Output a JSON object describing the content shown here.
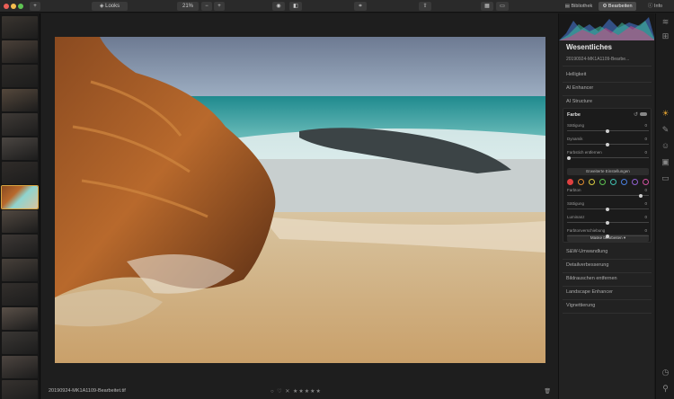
{
  "toolbar": {
    "add_label": "+",
    "looks_label": "Looks",
    "zoom_label": "21%",
    "zoom_out": "−",
    "zoom_in": "+",
    "tab_bibliothek": "Bibliothek",
    "tab_bearbeiten": "Bearbeiten",
    "tab_info": "Info"
  },
  "canvas": {
    "filename": "20190924-MK1A1109-Bearbeitet.tif",
    "rating": "○ ♡ ✕ ★★★★★"
  },
  "panel": {
    "title": "Wesentliches",
    "subtitle": "20190924-MK1A1109-Bearbe...",
    "sections_top": [
      "Helligkeit",
      "AI Enhancer",
      "AI Structure"
    ],
    "farbe": {
      "title": "Farbe",
      "sliders_top": [
        {
          "label": "Sättigung",
          "value": "0"
        },
        {
          "label": "Dynamik",
          "value": "0"
        },
        {
          "label": "Farbstich entfernen",
          "value": "0"
        }
      ],
      "advanced_label": "Erweiterte Einstellungen",
      "sliders_bottom": [
        {
          "label": "Farbton",
          "value": "0"
        },
        {
          "label": "Sättigung",
          "value": "0"
        },
        {
          "label": "Luminanz",
          "value": "0"
        },
        {
          "label": "Farbtonverschiebung",
          "value": "0"
        }
      ],
      "mask_label": "Maske bearbeiten ▾"
    },
    "sections_bottom": [
      "S&W-Umwandlung",
      "Detailverbesserung",
      "Bildrauschen entfernen",
      "Landscape Enhancer",
      "Vignettierung"
    ]
  },
  "colors": {
    "accent": "#e0a030",
    "swatches": [
      "#e04040",
      "#e08a30",
      "#d8c840",
      "#5cc050",
      "#40c0b0",
      "#4a80e0",
      "#9060d0",
      "#d050a0"
    ]
  }
}
